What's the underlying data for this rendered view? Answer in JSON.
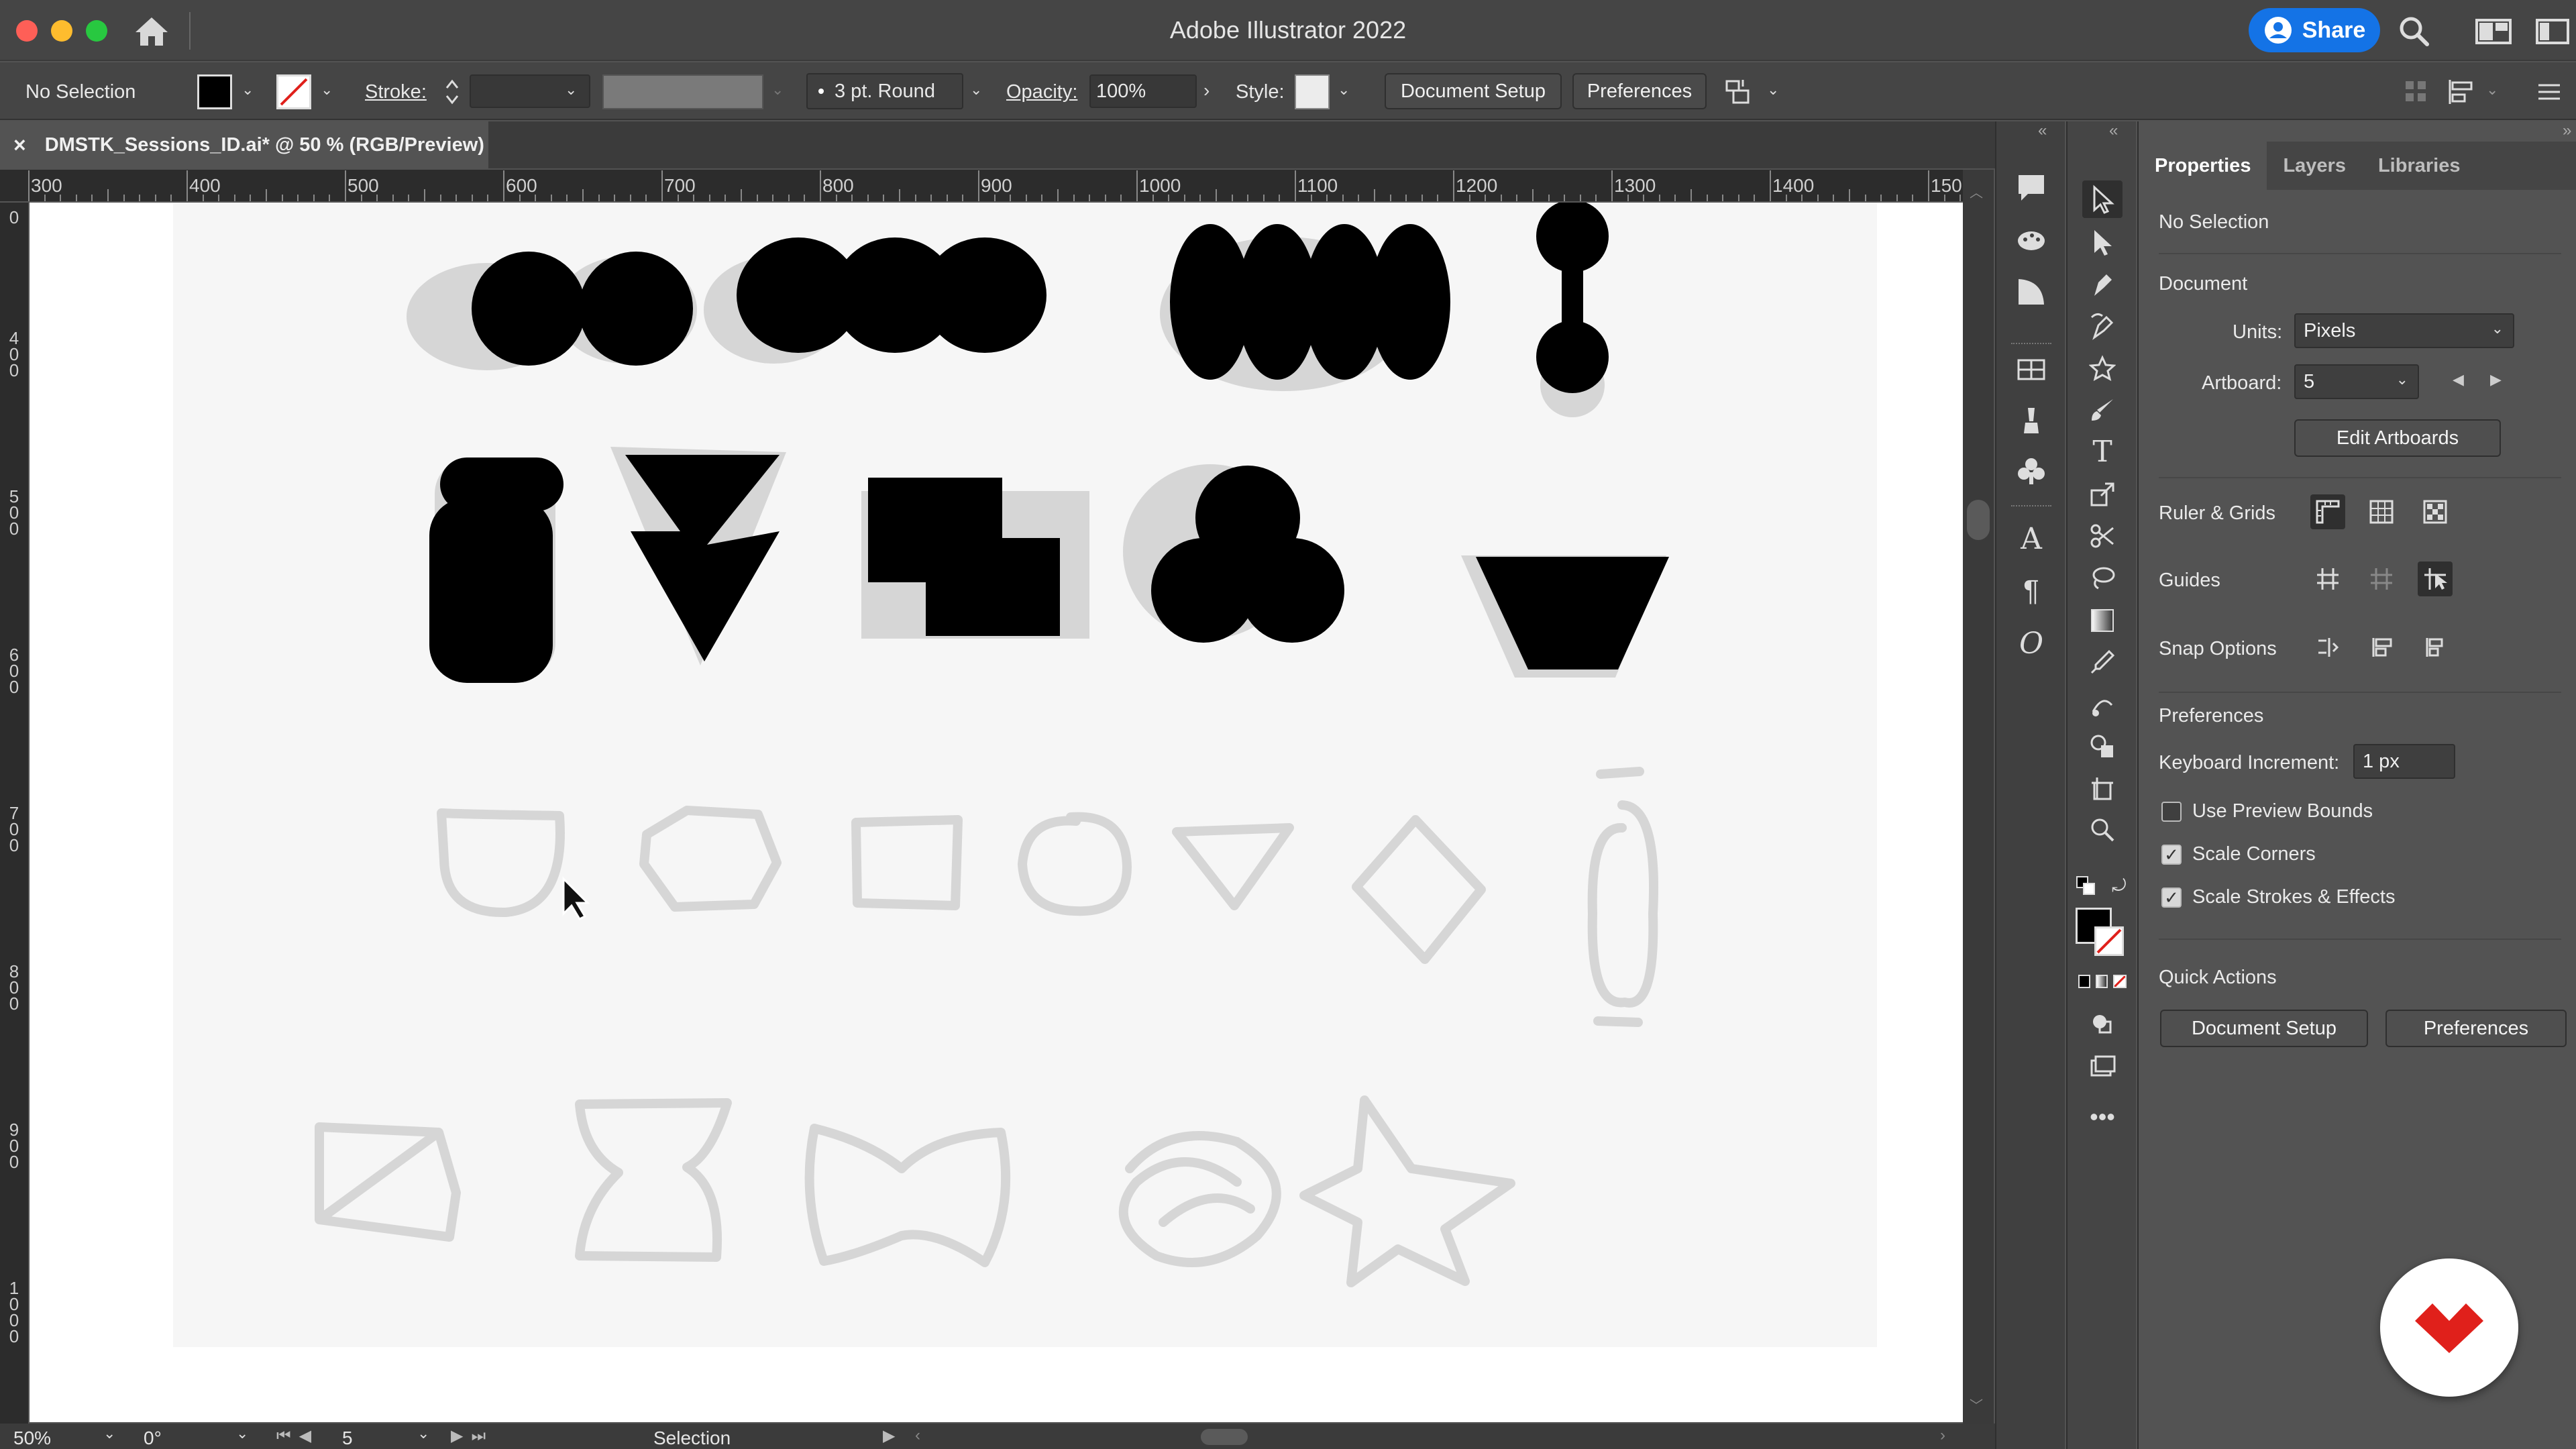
{
  "app": {
    "title": "Adobe Illustrator 2022",
    "share_label": "Share"
  },
  "controlbar": {
    "selection": "No Selection",
    "stroke_label": "Stroke:",
    "brush_label": "3 pt. Round",
    "opacity_label": "Opacity:",
    "opacity_value": "100%",
    "style_label": "Style:",
    "document_setup": "Document Setup",
    "preferences": "Preferences"
  },
  "document": {
    "tab_title": "DMSTK_Sessions_ID.ai* @ 50 % (RGB/Preview)",
    "close_symbol": "×"
  },
  "rulers": {
    "horizontal": [
      "300",
      "400",
      "500",
      "600",
      "700",
      "800",
      "900",
      "1000",
      "1100",
      "1200",
      "1300",
      "1400",
      "150"
    ],
    "vertical": [
      "0",
      "400",
      "500",
      "600",
      "700",
      "800",
      "900",
      "1000"
    ]
  },
  "statusbar": {
    "zoom": "50%",
    "rotation": "0°",
    "artboard": "5",
    "tool": "Selection"
  },
  "properties": {
    "tabs": [
      "Properties",
      "Layers",
      "Libraries"
    ],
    "selection": "No Selection",
    "document_heading": "Document",
    "units_label": "Units:",
    "units_value": "Pixels",
    "artboard_label": "Artboard:",
    "artboard_value": "5",
    "edit_artboards": "Edit Artboards",
    "ruler_grids": "Ruler & Grids",
    "guides": "Guides",
    "snap_options": "Snap Options",
    "preferences_heading": "Preferences",
    "keyboard_increment_label": "Keyboard Increment:",
    "keyboard_increment_value": "1 px",
    "use_preview_bounds": "Use Preview Bounds",
    "scale_corners": "Scale Corners",
    "scale_strokes": "Scale Strokes & Effects",
    "quick_actions": "Quick Actions",
    "qa_document_setup": "Document Setup",
    "qa_preferences": "Preferences"
  },
  "colors": {
    "accent": "#1473e6",
    "badge_red": "#e0201b",
    "shape_fill": "#000000",
    "sketch_stroke": "#d4d4d4"
  }
}
